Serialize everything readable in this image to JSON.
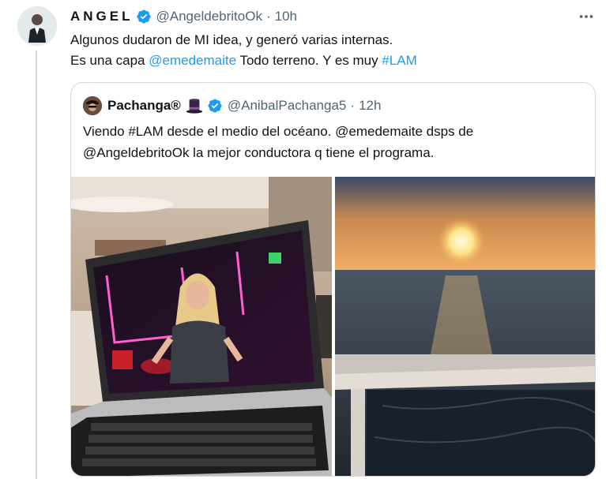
{
  "tweet": {
    "display_name": "ANGEL",
    "handle": "@AngeldebritoOk",
    "separator": "·",
    "time": "10h",
    "text_line1": "Algunos dudaron de MI idea, y generó varias internas.",
    "text_line2_prefix": "Es una capa ",
    "mention": "@emedemaite",
    "text_line2_middle": " Todo terreno. Y es muy ",
    "hashtag": "#LAM"
  },
  "quoted": {
    "display_name": "Pachanga®",
    "handle": "@AnibalPachanga5",
    "separator": "·",
    "time": "12h",
    "text_line1": "Viendo #LAM desde el medio del océano.  @emedemaite dsps de",
    "text_line2": "@AngeldebritoOk la mejor conductora q tiene el programa."
  },
  "icons": {
    "verified": "verified-badge-icon",
    "more": "more-options-icon",
    "hat": "top-hat-emoji-icon"
  },
  "colors": {
    "link": "#1d9bf0",
    "verified": "#1d9bf0",
    "secondary_text": "#536471",
    "border": "#cfd9de"
  }
}
